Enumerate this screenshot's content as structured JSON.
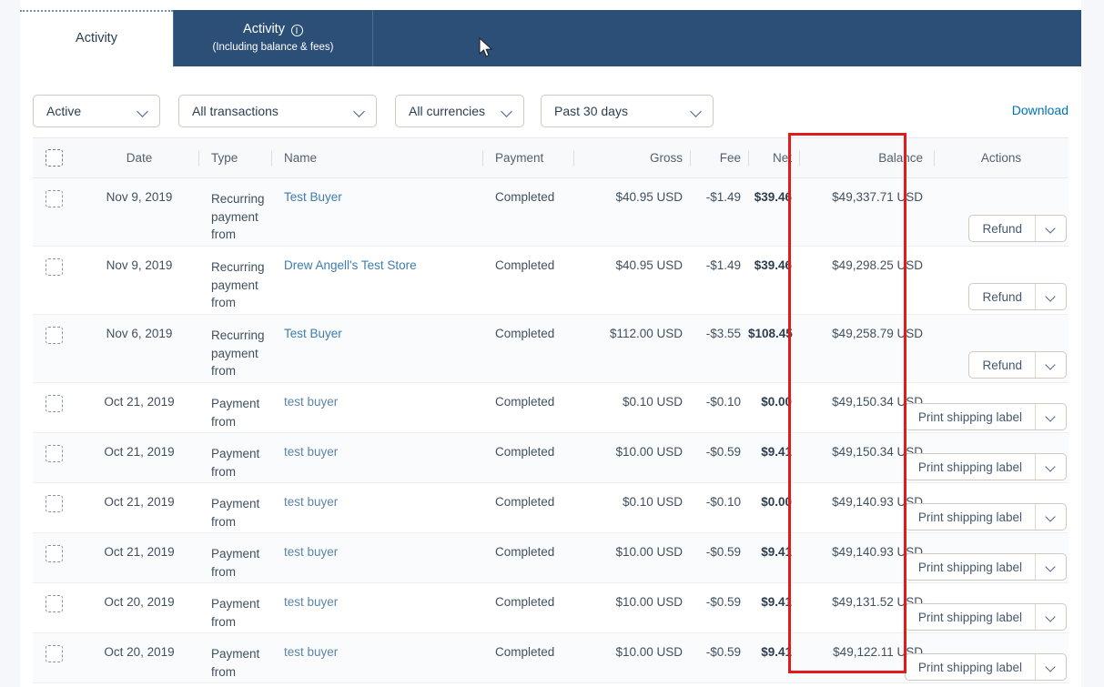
{
  "tabs": [
    {
      "label": "Activity",
      "sub": "",
      "active": true,
      "icon": ""
    },
    {
      "label": "Activity",
      "sub": "(Including balance & fees)",
      "active": false,
      "icon": "info-circle-icon"
    }
  ],
  "filters": [
    {
      "name": "status-filter",
      "value": "Active"
    },
    {
      "name": "transaction-filter",
      "value": "All transactions"
    },
    {
      "name": "currency-filter",
      "value": "All currencies"
    },
    {
      "name": "date-range-filter",
      "value": "Past 30 days"
    }
  ],
  "download_label": "Download",
  "table": {
    "columns": [
      "Date",
      "Type",
      "Name",
      "Payment",
      "Gross",
      "Fee",
      "Net",
      "Balance",
      "Actions"
    ],
    "rows": [
      {
        "date": "Nov 9, 2019",
        "type": "Recurring payment from",
        "name": "Test Buyer",
        "payment": "Completed",
        "gross": "$40.95 USD",
        "fee": "-$1.49",
        "net": "$39.46",
        "balance": "$49,337.71 USD",
        "action": "Refund"
      },
      {
        "date": "Nov 9, 2019",
        "type": "Recurring payment from",
        "name": "Drew Angell's Test Store",
        "payment": "Completed",
        "gross": "$40.95 USD",
        "fee": "-$1.49",
        "net": "$39.46",
        "balance": "$49,298.25 USD",
        "action": "Refund"
      },
      {
        "date": "Nov 6, 2019",
        "type": "Recurring payment from",
        "name": "Test Buyer",
        "payment": "Completed",
        "gross": "$112.00 USD",
        "fee": "-$3.55",
        "net": "$108.45",
        "balance": "$49,258.79 USD",
        "action": "Refund"
      },
      {
        "date": "Oct 21, 2019",
        "type": "Payment from",
        "name": "test buyer",
        "payment": "Completed",
        "gross": "$0.10 USD",
        "fee": "-$0.10",
        "net": "$0.00",
        "balance": "$49,150.34 USD",
        "action": "Print shipping label"
      },
      {
        "date": "Oct 21, 2019",
        "type": "Payment from",
        "name": "test buyer",
        "payment": "Completed",
        "gross": "$10.00 USD",
        "fee": "-$0.59",
        "net": "$9.41",
        "balance": "$49,150.34 USD",
        "action": "Print shipping label"
      },
      {
        "date": "Oct 21, 2019",
        "type": "Payment from",
        "name": "test buyer",
        "payment": "Completed",
        "gross": "$0.10 USD",
        "fee": "-$0.10",
        "net": "$0.00",
        "balance": "$49,140.93 USD",
        "action": "Print shipping label"
      },
      {
        "date": "Oct 21, 2019",
        "type": "Payment from",
        "name": "test buyer",
        "payment": "Completed",
        "gross": "$10.00 USD",
        "fee": "-$0.59",
        "net": "$9.41",
        "balance": "$49,140.93 USD",
        "action": "Print shipping label"
      },
      {
        "date": "Oct 20, 2019",
        "type": "Payment from",
        "name": "test buyer",
        "payment": "Completed",
        "gross": "$10.00 USD",
        "fee": "-$0.59",
        "net": "$9.41",
        "balance": "$49,131.52 USD",
        "action": "Print shipping label"
      },
      {
        "date": "Oct 20, 2019",
        "type": "Payment from",
        "name": "test buyer",
        "payment": "Completed",
        "gross": "$10.00 USD",
        "fee": "-$0.59",
        "net": "$9.41",
        "balance": "$49,122.11 USD",
        "action": "Print shipping label"
      }
    ]
  },
  "annotation": {
    "name": "balance-column-highlight",
    "color": "#e01b1b"
  },
  "colors": {
    "tab_blue": "#2b4f76",
    "link_blue": "#0070ba",
    "accent_red": "#e01b1b"
  }
}
